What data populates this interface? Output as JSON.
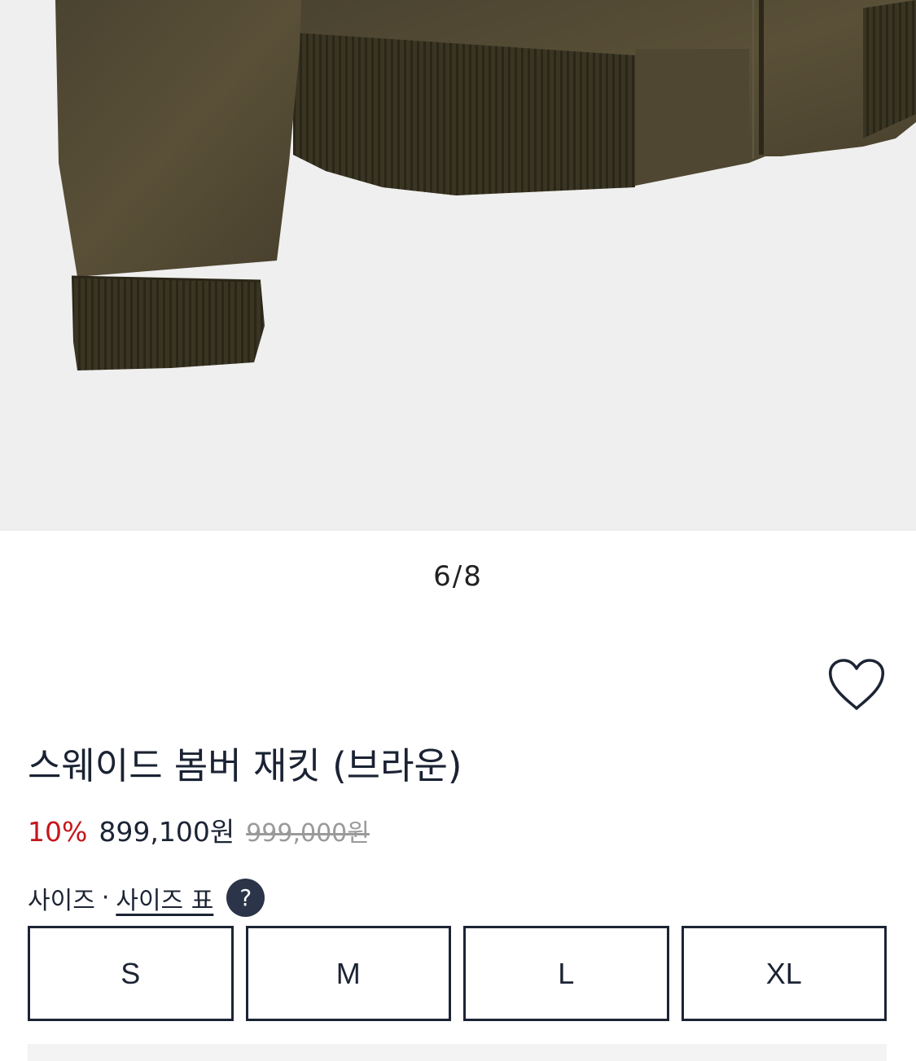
{
  "gallery": {
    "current_page": "6",
    "separator": "/",
    "total_pages": "8",
    "image_alt": "product-photo-jacket-hem-and-cuff"
  },
  "wishlist": {
    "icon": "heart-outline-icon"
  },
  "product": {
    "title": "스웨이드 봄버 재킷 (브라운)",
    "discount": "10%",
    "price": "899,100원",
    "original_price": "999,000원"
  },
  "size_selector": {
    "label": "사이즈",
    "dot": "·",
    "chart_link": "사이즈 표",
    "help": "?",
    "options": [
      "S",
      "M",
      "L",
      "XL"
    ]
  },
  "colors": {
    "discount": "#c4161c",
    "text": "#1c2434",
    "help_badge": "#2b3448",
    "image_bg": "#efefef"
  }
}
